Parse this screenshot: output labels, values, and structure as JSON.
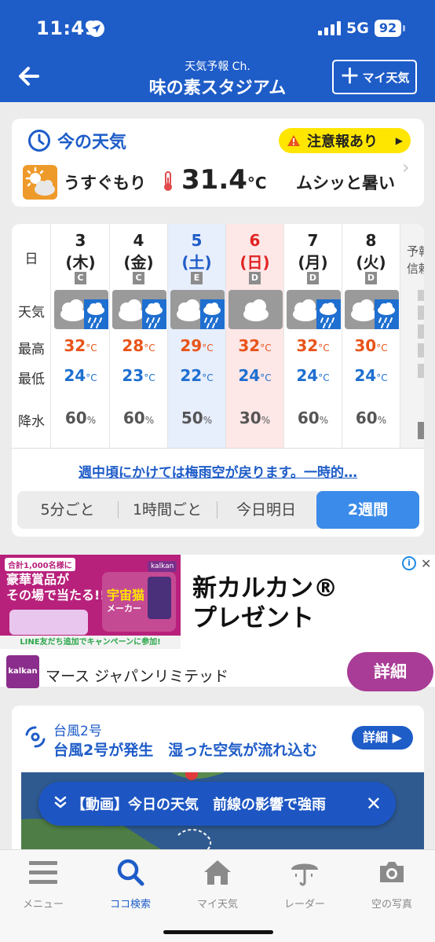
{
  "status": {
    "time": "11:49",
    "network": "5G",
    "battery": "92"
  },
  "header": {
    "subtitle": "天気予報 Ch.",
    "title": "味の素スタジアム",
    "my_weather_label": "マイ天気"
  },
  "now": {
    "title": "今の天気",
    "alert": "注意報あり",
    "condition": "うすぐもり",
    "temp": "31.4",
    "temp_unit": "°C",
    "feel": "ムシッと暑い"
  },
  "forecast": {
    "row_labels": {
      "day": "日",
      "weather": "天気",
      "high": "最高",
      "low": "最低",
      "rain": "降水"
    },
    "unit_c": "°C",
    "unit_pct": "%",
    "days": [
      {
        "date": "3",
        "dow": "(木)",
        "rank": "C",
        "weather": "cloudy-rain",
        "high": "32",
        "low": "24",
        "rain": "60"
      },
      {
        "date": "4",
        "dow": "(金)",
        "rank": "C",
        "weather": "cloudy-rain",
        "high": "28",
        "low": "23",
        "rain": "60"
      },
      {
        "date": "5",
        "dow": "(土)",
        "rank": "E",
        "weather": "cloudy-rain",
        "high": "29",
        "low": "22",
        "rain": "50"
      },
      {
        "date": "6",
        "dow": "(日)",
        "rank": "D",
        "weather": "cloudy",
        "high": "32",
        "low": "24",
        "rain": "30"
      },
      {
        "date": "7",
        "dow": "(月)",
        "rank": "D",
        "weather": "cloudy-rain",
        "high": "32",
        "low": "24",
        "rain": "60"
      },
      {
        "date": "8",
        "dow": "(火)",
        "rank": "D",
        "weather": "cloudy-rain",
        "high": "30",
        "low": "24",
        "rain": "60"
      }
    ],
    "extra_col_text": "予報",
    "extra_col_text2": "信頼",
    "comment": "週中頃にかけては梅雨空が戻ります。一時的…",
    "tabs": [
      "5分ごと",
      "1時間ごと",
      "今日明日",
      "2週間"
    ],
    "active_tab": "2週間"
  },
  "ad": {
    "headline_line1": "新カルカン®",
    "headline_line2": "プレゼント",
    "company": "マース ジャパンリミテッド",
    "detail_label": "詳細",
    "logo_text": "kalkan",
    "banner_top": "合計1,000名様に",
    "banner_main1": "豪華賞品が",
    "banner_main2": "その場で当たる!!",
    "banner_line": "LINE友だち追加でキャンペーンに参加!",
    "banner_product": "宇宙猫",
    "banner_product_sub": "メーカー",
    "banner_brand": "kalkan"
  },
  "typhoon": {
    "sub": "台風2号",
    "title": "台風2号が発生　湿った空気が流れ込む",
    "detail_label": "詳細",
    "video_banner": "【動画】今日の天気　前線の影響で強雨"
  },
  "nav": [
    {
      "label": "メニュー",
      "icon": "menu-icon"
    },
    {
      "label": "ココ検索",
      "icon": "search-icon"
    },
    {
      "label": "マイ天気",
      "icon": "home-icon"
    },
    {
      "label": "レーダー",
      "icon": "umbrella-icon"
    },
    {
      "label": "空の写真",
      "icon": "camera-icon"
    }
  ],
  "colors": {
    "brand": "#1e5cc8",
    "high": "#e8541a",
    "low": "#1e6fd0",
    "alert": "#ffe600",
    "tab_active": "#3b8bea",
    "ad_button": "#a93c96"
  }
}
